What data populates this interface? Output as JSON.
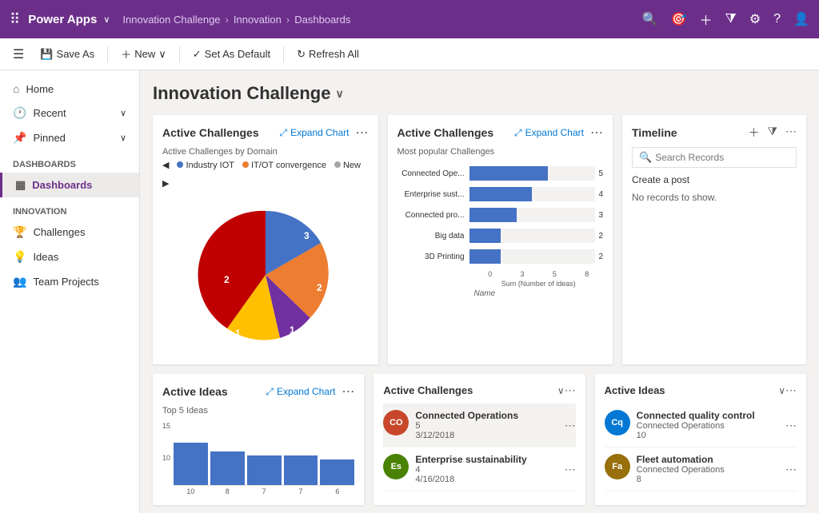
{
  "topnav": {
    "brand": "Power Apps",
    "app": "Innovation Challenge",
    "breadcrumb1": "Innovation",
    "breadcrumb2": "Dashboards"
  },
  "toolbar": {
    "save_as": "Save As",
    "new": "New",
    "set_default": "Set As Default",
    "refresh": "Refresh All"
  },
  "sidebar": {
    "home": "Home",
    "recent": "Recent",
    "pinned": "Pinned",
    "dashboards_section": "Dashboards",
    "dashboards": "Dashboards",
    "innovation_section": "Innovation",
    "challenges": "Challenges",
    "ideas": "Ideas",
    "team_projects": "Team Projects"
  },
  "page_title": "Innovation Challenge",
  "card1": {
    "title": "Active Challenges",
    "expand": "Expand Chart",
    "subtitle": "Active Challenges by Domain",
    "legend": [
      {
        "label": "Industry IOT",
        "color": "#4472c4"
      },
      {
        "label": "IT/OT convergence",
        "color": "#ed7d31"
      },
      {
        "label": "New",
        "color": "#a5a5a5"
      }
    ],
    "pie_data": [
      {
        "label": "3",
        "value": 3,
        "color": "#4472c4",
        "startAngle": 0,
        "sweep": 120
      },
      {
        "label": "2",
        "value": 2,
        "color": "#ed7d31",
        "startAngle": 120,
        "sweep": 80
      },
      {
        "label": "1",
        "value": 1,
        "color": "#7030a0",
        "startAngle": 200,
        "sweep": 40
      },
      {
        "label": "1",
        "value": 1,
        "color": "#ffc000",
        "startAngle": 240,
        "sweep": 40
      },
      {
        "label": "2",
        "value": 2,
        "color": "#ff0000",
        "startAngle": 280,
        "sweep": 80
      }
    ]
  },
  "card2": {
    "title": "Active Challenges",
    "expand": "Expand Chart",
    "subtitle": "Most popular Challenges",
    "bars": [
      {
        "label": "Connected Ope...",
        "value": 5,
        "max": 8
      },
      {
        "label": "Enterprise sust...",
        "value": 4,
        "max": 8
      },
      {
        "label": "Connected pro...",
        "value": 3,
        "max": 8
      },
      {
        "label": "Big data",
        "value": 2,
        "max": 8
      },
      {
        "label": "3D Printing",
        "value": 2,
        "max": 8
      }
    ],
    "x_axis": [
      0,
      3,
      5,
      8
    ],
    "x_title": "Sum (Number of ideas)"
  },
  "timeline": {
    "title": "Timeline",
    "search_placeholder": "Search Records",
    "create_post": "Create a post",
    "no_records": "No records to show."
  },
  "bottom_card1": {
    "title": "Active Ideas",
    "expand": "Expand Chart",
    "subtitle": "Top 5 Ideas",
    "y_max": 15,
    "bars": [
      {
        "value": 10,
        "label": ""
      },
      {
        "value": 8,
        "label": ""
      },
      {
        "value": 7,
        "label": ""
      },
      {
        "value": 7,
        "label": ""
      },
      {
        "value": 6,
        "label": ""
      }
    ],
    "y_labels": [
      15,
      10
    ]
  },
  "bottom_card2": {
    "title": "Active Challenges",
    "items": [
      {
        "name": "Connected Operations",
        "count": "5",
        "date": "3/12/2018",
        "initials": "CO",
        "color": "#c8472b"
      },
      {
        "name": "Enterprise sustainability",
        "count": "4",
        "date": "4/16/2018",
        "initials": "Es",
        "color": "#498205"
      }
    ]
  },
  "bottom_card3": {
    "title": "Active Ideas",
    "items": [
      {
        "name": "Connected quality control",
        "sub": "Connected Operations",
        "count": "10",
        "initials": "Cq",
        "color": "#0078d4"
      },
      {
        "name": "Fleet automation",
        "sub": "Connected Operations",
        "count": "8",
        "initials": "Fa",
        "color": "#986f0b"
      }
    ]
  }
}
